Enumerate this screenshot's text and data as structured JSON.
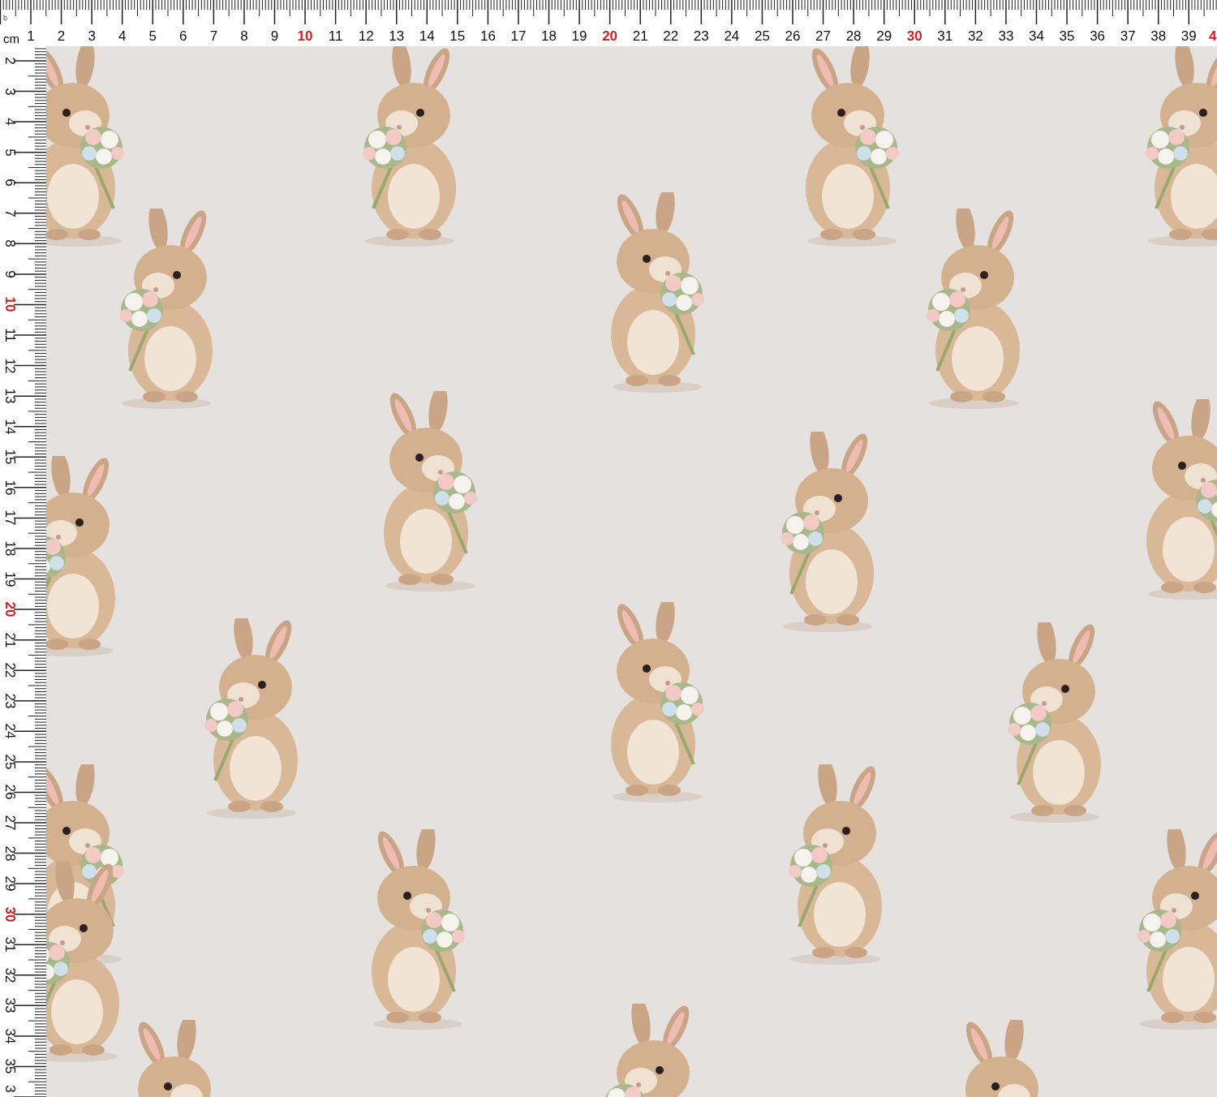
{
  "top_ruler": {
    "corner_mark": "b",
    "unit": "cm",
    "labels": [
      {
        "text": "1",
        "color": "#111111"
      },
      {
        "text": "2",
        "color": "#111111"
      },
      {
        "text": "3",
        "color": "#111111"
      },
      {
        "text": "4",
        "color": "#111111"
      },
      {
        "text": "5",
        "color": "#111111"
      },
      {
        "text": "6",
        "color": "#111111"
      },
      {
        "text": "7",
        "color": "#111111"
      },
      {
        "text": "8",
        "color": "#111111"
      },
      {
        "text": "9",
        "color": "#111111"
      },
      {
        "text": "10",
        "color": "#d42020"
      },
      {
        "text": "11",
        "color": "#111111"
      },
      {
        "text": "12",
        "color": "#111111"
      },
      {
        "text": "13",
        "color": "#111111"
      },
      {
        "text": "14",
        "color": "#111111"
      },
      {
        "text": "15",
        "color": "#111111"
      },
      {
        "text": "16",
        "color": "#111111"
      },
      {
        "text": "17",
        "color": "#111111"
      },
      {
        "text": "18",
        "color": "#111111"
      },
      {
        "text": "19",
        "color": "#111111"
      },
      {
        "text": "20",
        "color": "#d42020"
      },
      {
        "text": "21",
        "color": "#111111"
      },
      {
        "text": "22",
        "color": "#111111"
      },
      {
        "text": "23",
        "color": "#111111"
      },
      {
        "text": "24",
        "color": "#111111"
      },
      {
        "text": "25",
        "color": "#111111"
      },
      {
        "text": "26",
        "color": "#111111"
      },
      {
        "text": "27",
        "color": "#111111"
      },
      {
        "text": "28",
        "color": "#111111"
      },
      {
        "text": "29",
        "color": "#111111"
      },
      {
        "text": "30",
        "color": "#d42020"
      },
      {
        "text": "31",
        "color": "#111111"
      },
      {
        "text": "32",
        "color": "#111111"
      },
      {
        "text": "33",
        "color": "#111111"
      },
      {
        "text": "34",
        "color": "#111111"
      },
      {
        "text": "35",
        "color": "#111111"
      },
      {
        "text": "36",
        "color": "#111111"
      },
      {
        "text": "37",
        "color": "#111111"
      },
      {
        "text": "38",
        "color": "#111111"
      },
      {
        "text": "39",
        "color": "#111111"
      },
      {
        "text": "4",
        "color": "#d42020"
      }
    ]
  },
  "left_ruler": {
    "labels": [
      {
        "text": "2",
        "color": "#111111"
      },
      {
        "text": "3",
        "color": "#111111"
      },
      {
        "text": "4",
        "color": "#111111"
      },
      {
        "text": "5",
        "color": "#111111"
      },
      {
        "text": "6",
        "color": "#111111"
      },
      {
        "text": "7",
        "color": "#111111"
      },
      {
        "text": "8",
        "color": "#111111"
      },
      {
        "text": "9",
        "color": "#111111"
      },
      {
        "text": "10",
        "color": "#d42020"
      },
      {
        "text": "11",
        "color": "#111111"
      },
      {
        "text": "12",
        "color": "#111111"
      },
      {
        "text": "13",
        "color": "#111111"
      },
      {
        "text": "14",
        "color": "#111111"
      },
      {
        "text": "15",
        "color": "#111111"
      },
      {
        "text": "16",
        "color": "#111111"
      },
      {
        "text": "17",
        "color": "#111111"
      },
      {
        "text": "18",
        "color": "#111111"
      },
      {
        "text": "19",
        "color": "#111111"
      },
      {
        "text": "20",
        "color": "#d42020"
      },
      {
        "text": "21",
        "color": "#111111"
      },
      {
        "text": "22",
        "color": "#111111"
      },
      {
        "text": "23",
        "color": "#111111"
      },
      {
        "text": "24",
        "color": "#111111"
      },
      {
        "text": "25",
        "color": "#111111"
      },
      {
        "text": "26",
        "color": "#111111"
      },
      {
        "text": "27",
        "color": "#111111"
      },
      {
        "text": "28",
        "color": "#111111"
      },
      {
        "text": "29",
        "color": "#111111"
      },
      {
        "text": "30",
        "color": "#d42020"
      },
      {
        "text": "31",
        "color": "#111111"
      },
      {
        "text": "32",
        "color": "#111111"
      },
      {
        "text": "33",
        "color": "#111111"
      },
      {
        "text": "34",
        "color": "#111111"
      },
      {
        "text": "35",
        "color": "#111111"
      },
      {
        "text": "3",
        "color": "#111111"
      }
    ]
  }
}
